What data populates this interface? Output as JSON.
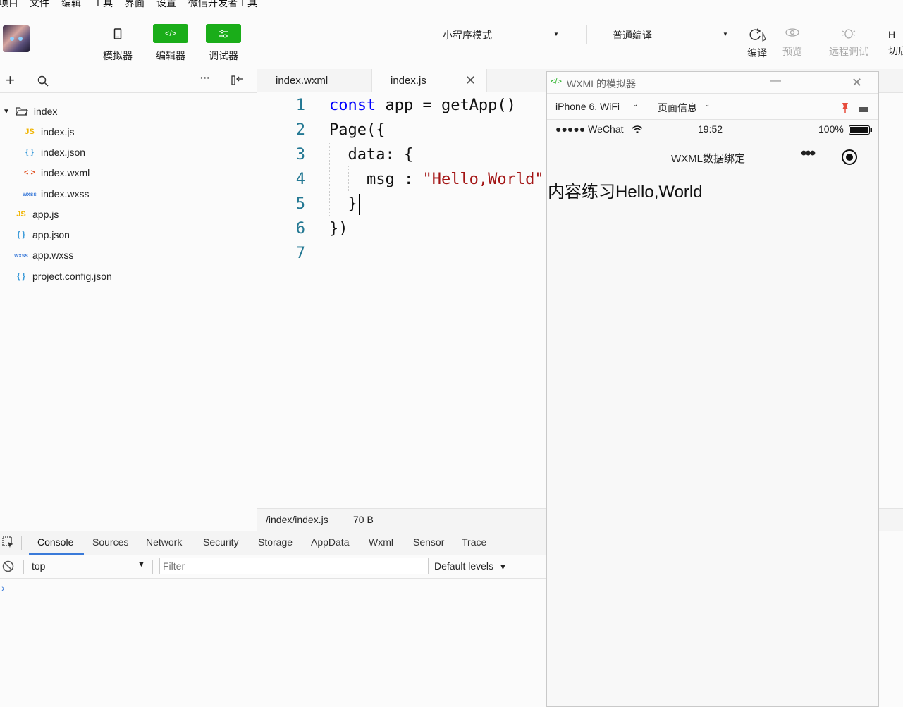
{
  "menu": [
    "项目",
    "文件",
    "编辑",
    "工具",
    "界面",
    "设置",
    "微信开发者工具"
  ],
  "toolbar": {
    "simulator_label": "模拟器",
    "editor_label": "编辑器",
    "debugger_label": "调试器",
    "mode_select": "小程序模式",
    "compile_select": "普通编译",
    "compile_label": "编译",
    "preview_label": "预览",
    "remote_debug_label": "远程调试",
    "cut_label": "切后",
    "accent_color": "#1aad19"
  },
  "sidebar": {
    "folder": "index",
    "items": [
      {
        "icon": "JS",
        "name": "index.js"
      },
      {
        "icon": "{ }",
        "name": "index.json"
      },
      {
        "icon": "< >",
        "name": "index.wxml"
      },
      {
        "icon": "wxss",
        "name": "index.wxss"
      },
      {
        "icon": "JS",
        "name": "app.js"
      },
      {
        "icon": "{ }",
        "name": "app.json"
      },
      {
        "icon": "wxss",
        "name": "app.wxss"
      },
      {
        "icon": "{ }",
        "name": "project.config.json"
      }
    ]
  },
  "editor": {
    "tabs": [
      "index.wxml",
      "index.js"
    ],
    "line_numbers": [
      "1",
      "2",
      "3",
      "4",
      "5",
      "6",
      "7"
    ],
    "code": {
      "l1_kw": "const",
      "l1_rest": " app = getApp()",
      "l2": "Page({",
      "l3": "  data: {",
      "l4_key": "    msg : ",
      "l4_str": "\"Hello,World\"",
      "l5": "  }",
      "l6": "})"
    }
  },
  "status": {
    "path": "/index/index.js",
    "size": "70 B"
  },
  "devtools": {
    "tabs": [
      "Console",
      "Sources",
      "Network",
      "Security",
      "Storage",
      "AppData",
      "Wxml",
      "Sensor",
      "Trace"
    ],
    "context": "top",
    "filter_placeholder": "Filter",
    "levels": "Default levels"
  },
  "simulator": {
    "title": "WXML的模拟器",
    "device": "iPhone 6, WiFi",
    "page_info": "页面信息",
    "signal": "●●●●● WeChat",
    "time": "19:52",
    "battery": "100%",
    "nav_title": "WXML数据绑定",
    "content": "内容练习Hello,World"
  }
}
